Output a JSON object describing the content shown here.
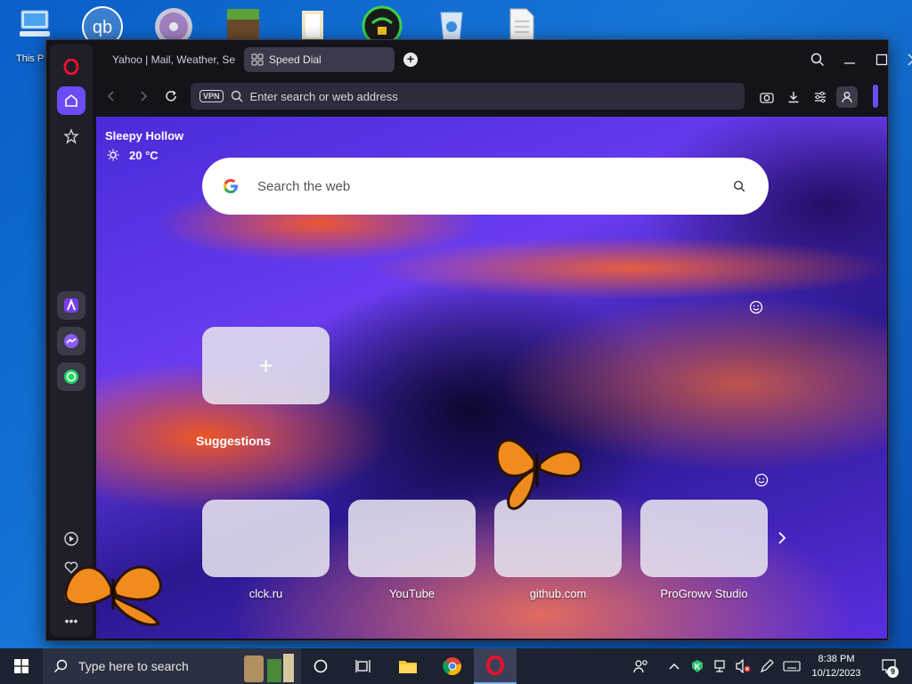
{
  "desktop": {
    "this_pc_label": "This P"
  },
  "browser": {
    "tabs": [
      {
        "label": "Yahoo | Mail, Weather, Se",
        "active": false
      },
      {
        "label": "Speed Dial",
        "active": true
      }
    ],
    "address_placeholder": "Enter search or web address",
    "vpn_label": "VPN"
  },
  "weather": {
    "city": "Sleepy Hollow",
    "temperature": "20 °C",
    "icon": "sun-icon"
  },
  "search": {
    "placeholder": "Search the web"
  },
  "speed_dial": {
    "add_label": "+"
  },
  "suggestions": {
    "title": "Suggestions",
    "items": [
      {
        "label": "clck.ru"
      },
      {
        "label": "YouTube"
      },
      {
        "label": "github.com"
      },
      {
        "label": "ProGrowv Studio"
      }
    ]
  },
  "taskbar": {
    "search_placeholder": "Type here to search",
    "time": "8:38 PM",
    "date": "10/12/2023",
    "notification_count": "9"
  },
  "colors": {
    "accent": "#6b4cf6",
    "opera_red": "#e8112d"
  }
}
